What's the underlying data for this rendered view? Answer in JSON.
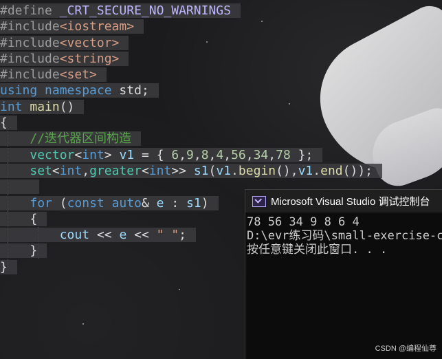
{
  "editor": {
    "lines": [
      [
        "#define ",
        "_CRT_SECURE_NO_WARNINGS"
      ],
      [
        "#include",
        "<iostream>"
      ],
      [
        "#include",
        "<vector>"
      ],
      [
        "#include",
        "<string>"
      ],
      [
        "#include",
        "<set>"
      ],
      [
        "using",
        "namespace",
        "std",
        ";"
      ],
      [
        "int",
        "main",
        "()"
      ],
      [
        "{"
      ],
      [
        "//迭代器区间构造"
      ],
      [
        "vector",
        "<",
        "int",
        ">",
        "v1",
        " = { ",
        "6",
        ",",
        "9",
        ",",
        "8",
        ",",
        "4",
        ",",
        "56",
        ",",
        "34",
        ",",
        "78",
        " };"
      ],
      [
        "set",
        "<",
        "int",
        ",",
        "greater",
        "<",
        "int",
        ">>",
        "s1",
        "(",
        "v1",
        ".",
        "begin",
        "(),",
        "v1",
        ".",
        "end",
        "());"
      ],
      [
        ""
      ],
      [
        "for",
        "(",
        "const",
        "auto",
        "&",
        "e",
        ":",
        "s1",
        ")"
      ],
      [
        "{"
      ],
      [
        "cout",
        "<<",
        "e",
        "<<",
        "\" \"",
        ";"
      ],
      [
        "}"
      ],
      [
        "}"
      ]
    ]
  },
  "console": {
    "title": "Microsoft Visual Studio 调试控制台",
    "icon": "console-app-icon",
    "output": [
      "78 56 34 9 8 6 4",
      "D:\\evr练习码\\small-exercise-c",
      "按任意键关闭此窗口. . ."
    ]
  },
  "watermark": "CSDN @编程仙尊"
}
